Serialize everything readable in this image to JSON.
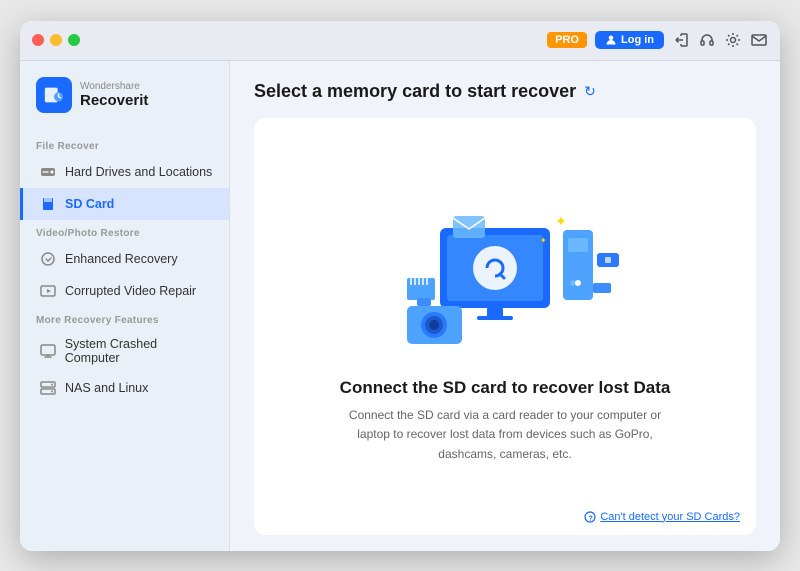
{
  "window": {
    "title": "Recoverit"
  },
  "titlebar": {
    "pro_label": "PRO",
    "login_label": "Log in"
  },
  "brand": {
    "sub": "Wondershare",
    "name": "Recoverit"
  },
  "sidebar": {
    "file_recover_label": "File Recover",
    "video_photo_label": "Video/Photo Restore",
    "more_features_label": "More Recovery Features",
    "items": [
      {
        "id": "hard-drives",
        "label": "Hard Drives and Locations",
        "active": false
      },
      {
        "id": "sd-card",
        "label": "SD Card",
        "active": true
      },
      {
        "id": "enhanced-recovery",
        "label": "Enhanced Recovery",
        "active": false
      },
      {
        "id": "corrupted-video",
        "label": "Corrupted Video Repair",
        "active": false
      },
      {
        "id": "system-crashed",
        "label": "System Crashed Computer",
        "active": false
      },
      {
        "id": "nas-linux",
        "label": "NAS and Linux",
        "active": false
      }
    ]
  },
  "content": {
    "title": "Select a memory card to start recover",
    "card_title": "Connect the SD card to recover lost Data",
    "card_desc": "Connect the SD card via a card reader to your computer or laptop to recover lost data from devices such as GoPro, dashcams, cameras, etc.",
    "cant_detect": "Can't detect your SD Cards?"
  }
}
